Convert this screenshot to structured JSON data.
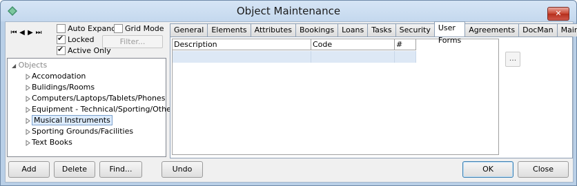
{
  "window": {
    "title": "Object Maintenance",
    "close_symbol": "✕"
  },
  "nav": {
    "first": "⏮",
    "prev": "◀",
    "next": "▶",
    "last": "⏭"
  },
  "options": {
    "auto_expand": "Auto Expand",
    "locked": "Locked",
    "active_only": "Active Only",
    "grid_mode": "Grid Mode",
    "filter_label": "Filter..."
  },
  "tree": {
    "root": "Objects",
    "items": [
      "Accomodation",
      "Bulidings/Rooms",
      "Computers/Laptops/Tablets/Phones",
      "Equipment - Technical/Sporting/Other",
      "Musical Instruments",
      "Sporting Grounds/Facilities",
      "Text Books"
    ],
    "selected_index": 4
  },
  "tabs": [
    "General",
    "Elements",
    "Attributes",
    "Bookings",
    "Loans",
    "Tasks",
    "Security",
    "User Forms",
    "Agreements",
    "DocMan",
    "Maint"
  ],
  "active_tab": "User Forms",
  "grid": {
    "columns": [
      "Description",
      "Code",
      "#"
    ]
  },
  "ellipsis_label": "...",
  "buttons": {
    "add": "Add",
    "delete": "Delete",
    "find": "Find...",
    "undo": "Undo",
    "ok": "OK",
    "close": "Close"
  },
  "colors": {
    "selection": "#dcebfc",
    "grid_row": "#dde8f5",
    "title_bg": "#c4d8ee"
  }
}
